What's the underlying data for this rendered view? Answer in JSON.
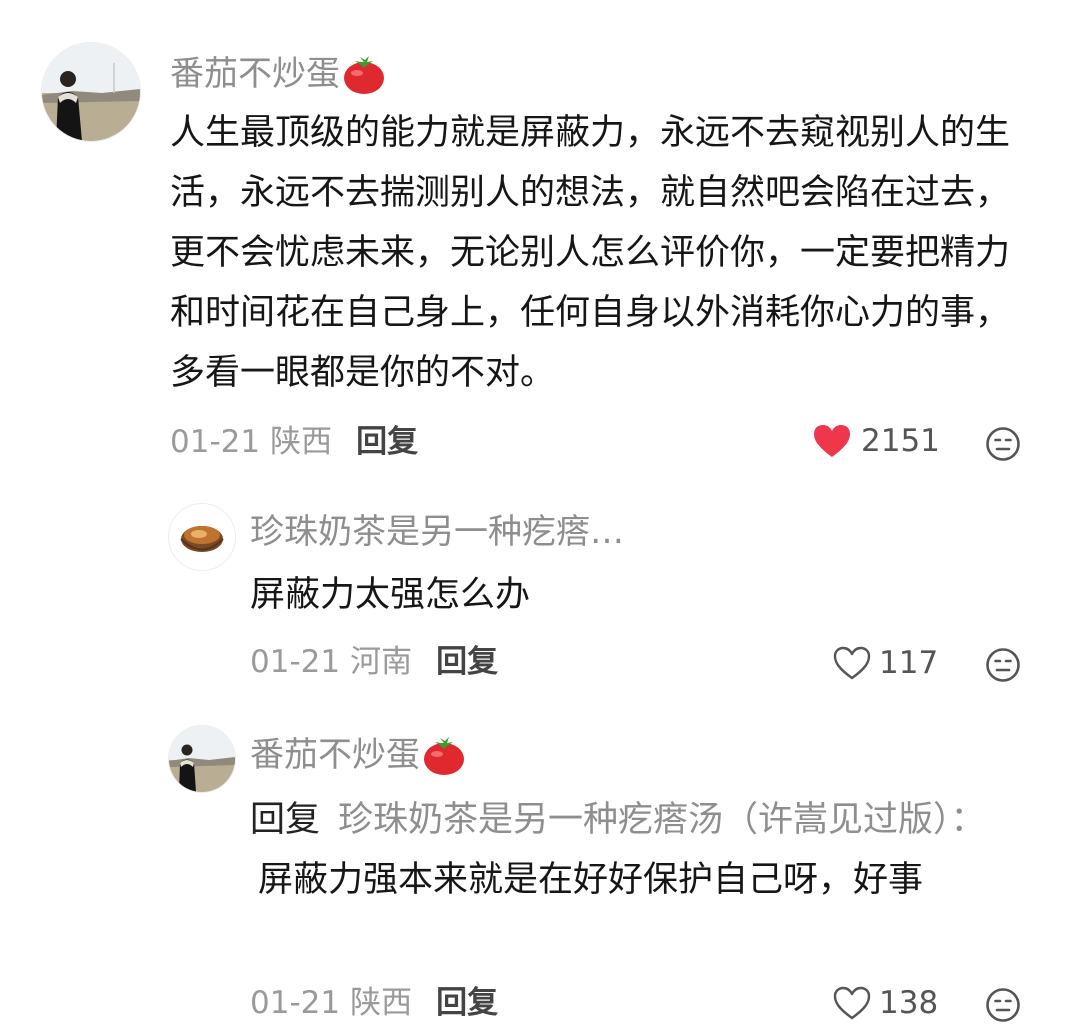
{
  "comments": [
    {
      "username": "番茄不炒蛋",
      "text": "人生最顶级的能力就是屏蔽力，永远不去窥视别人的生活，永远不去揣测别人的想法，就自然吧会陷在过去，更不会忧虑未来，无论别人怎么评价你，一定要把精力和时间花在自己身上，任何自身以外消耗你心力的事，多看一眼都是你的不对。",
      "date": "01-21",
      "location": "陕西",
      "reply_label": "回复",
      "likes": "2151",
      "liked": true
    }
  ],
  "replies": [
    {
      "username": "珍珠奶茶是另一种疙瘩…",
      "text": "屏蔽力太强怎么办",
      "date": "01-21",
      "location": "河南",
      "reply_label": "回复",
      "likes": "117",
      "liked": false
    },
    {
      "username": "番茄不炒蛋",
      "reply_prefix": "回复",
      "reply_target": "珍珠奶茶是另一种疙瘩汤（许嵩见过版）：",
      "text": "屏蔽力强本来就是在好好保护自己呀，好事",
      "date": "01-21",
      "location": "陕西",
      "reply_label": "回复",
      "likes": "138",
      "liked": false
    }
  ],
  "icons": {
    "heart_filled_color": "#f0364a",
    "heart_outline_color": "#555555",
    "tomato_color": "#e0292e"
  }
}
